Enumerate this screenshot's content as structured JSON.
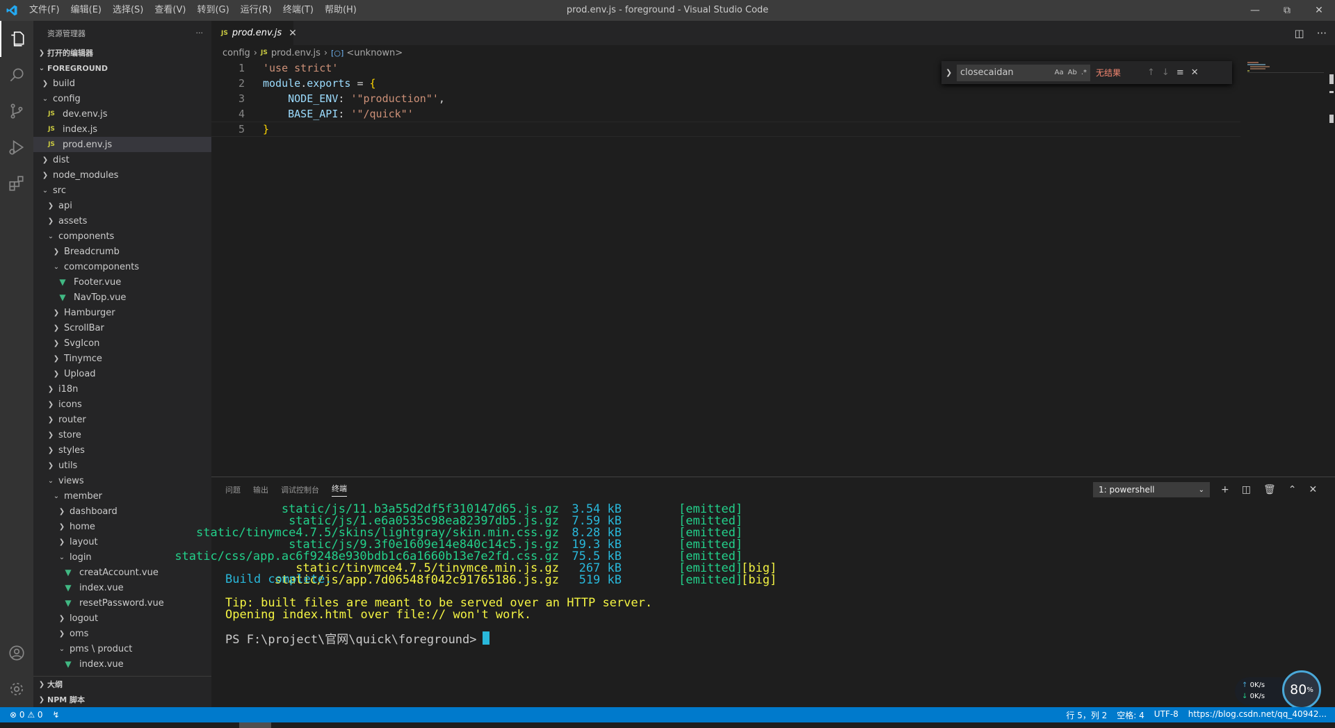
{
  "titlebar": {
    "menu": [
      "文件(F)",
      "编辑(E)",
      "选择(S)",
      "查看(V)",
      "转到(G)",
      "运行(R)",
      "终端(T)",
      "帮助(H)"
    ],
    "title": "prod.env.js - foreground - Visual Studio Code"
  },
  "sidebar": {
    "header": "资源管理器",
    "more": "···",
    "open_editors": "打开的编辑器",
    "root": "FOREGROUND",
    "tree": [
      {
        "label": "build",
        "depth": 0,
        "kind": "folder-closed"
      },
      {
        "label": "config",
        "depth": 0,
        "kind": "folder-open"
      },
      {
        "label": "dev.env.js",
        "depth": 1,
        "kind": "js"
      },
      {
        "label": "index.js",
        "depth": 1,
        "kind": "js"
      },
      {
        "label": "prod.env.js",
        "depth": 1,
        "kind": "js",
        "selected": true
      },
      {
        "label": "dist",
        "depth": 0,
        "kind": "folder-closed"
      },
      {
        "label": "node_modules",
        "depth": 0,
        "kind": "folder-closed"
      },
      {
        "label": "src",
        "depth": 0,
        "kind": "folder-open"
      },
      {
        "label": "api",
        "depth": 1,
        "kind": "folder-closed"
      },
      {
        "label": "assets",
        "depth": 1,
        "kind": "folder-closed"
      },
      {
        "label": "components",
        "depth": 1,
        "kind": "folder-open"
      },
      {
        "label": "Breadcrumb",
        "depth": 2,
        "kind": "folder-closed"
      },
      {
        "label": "comcomponents",
        "depth": 2,
        "kind": "folder-open"
      },
      {
        "label": "Footer.vue",
        "depth": 3,
        "kind": "vue"
      },
      {
        "label": "NavTop.vue",
        "depth": 3,
        "kind": "vue"
      },
      {
        "label": "Hamburger",
        "depth": 2,
        "kind": "folder-closed"
      },
      {
        "label": "ScrollBar",
        "depth": 2,
        "kind": "folder-closed"
      },
      {
        "label": "SvgIcon",
        "depth": 2,
        "kind": "folder-closed"
      },
      {
        "label": "Tinymce",
        "depth": 2,
        "kind": "folder-closed"
      },
      {
        "label": "Upload",
        "depth": 2,
        "kind": "folder-closed"
      },
      {
        "label": "i18n",
        "depth": 1,
        "kind": "folder-closed"
      },
      {
        "label": "icons",
        "depth": 1,
        "kind": "folder-closed"
      },
      {
        "label": "router",
        "depth": 1,
        "kind": "folder-closed"
      },
      {
        "label": "store",
        "depth": 1,
        "kind": "folder-closed"
      },
      {
        "label": "styles",
        "depth": 1,
        "kind": "folder-closed"
      },
      {
        "label": "utils",
        "depth": 1,
        "kind": "folder-closed"
      },
      {
        "label": "views",
        "depth": 1,
        "kind": "folder-open"
      },
      {
        "label": "member",
        "depth": 2,
        "kind": "folder-open"
      },
      {
        "label": "dashboard",
        "depth": 3,
        "kind": "folder-closed"
      },
      {
        "label": "home",
        "depth": 3,
        "kind": "folder-closed"
      },
      {
        "label": "layout",
        "depth": 3,
        "kind": "folder-closed"
      },
      {
        "label": "login",
        "depth": 3,
        "kind": "folder-open"
      },
      {
        "label": "creatAccount.vue",
        "depth": 4,
        "kind": "vue"
      },
      {
        "label": "index.vue",
        "depth": 4,
        "kind": "vue"
      },
      {
        "label": "resetPassword.vue",
        "depth": 4,
        "kind": "vue"
      },
      {
        "label": "logout",
        "depth": 3,
        "kind": "folder-closed"
      },
      {
        "label": "oms",
        "depth": 3,
        "kind": "folder-closed"
      },
      {
        "label": "pms \\ product",
        "depth": 3,
        "kind": "folder-open"
      },
      {
        "label": "index.vue",
        "depth": 4,
        "kind": "vue"
      }
    ],
    "outline": "大纲",
    "npm": "NPM 脚本"
  },
  "tabs": [
    {
      "label": "prod.env.js",
      "icon": "JS"
    }
  ],
  "breadcrumb": {
    "folder": "config",
    "file": "prod.env.js",
    "symbol": "<unknown>"
  },
  "editor": {
    "line_numbers": [
      "1",
      "2",
      "3",
      "4",
      "5"
    ]
  },
  "find": {
    "value": "closecaidan",
    "opt_case": "Aa",
    "opt_word": "Ab",
    "opt_regex": ".*",
    "no_results": "无结果"
  },
  "panel": {
    "tabs": [
      "问题",
      "输出",
      "调试控制台",
      "终端"
    ],
    "terminal_select": "1: powershell",
    "assets": [
      {
        "name": "static/js/11.b3a55d2df5f310147d65.js.gz",
        "size": "3.54 kB",
        "status": "[emitted]",
        "flag": "",
        "big": false
      },
      {
        "name": "static/js/1.e6a0535c98ea82397db5.js.gz",
        "size": "7.59 kB",
        "status": "[emitted]",
        "flag": "",
        "big": false
      },
      {
        "name": "static/tinymce4.7.5/skins/lightgray/skin.min.css.gz",
        "size": "8.28 kB",
        "status": "[emitted]",
        "flag": "",
        "big": false
      },
      {
        "name": "static/js/9.3f0e1609e14e840c14c5.js.gz",
        "size": "19.3 kB",
        "status": "[emitted]",
        "flag": "",
        "big": false
      },
      {
        "name": "static/css/app.ac6f9248e930bdb1c6a1660b13e7e2fd.css.gz",
        "size": "75.5 kB",
        "status": "[emitted]",
        "flag": "",
        "big": false
      },
      {
        "name": "static/tinymce4.7.5/tinymce.min.js.gz",
        "size": "267 kB",
        "status": "[emitted]",
        "flag": "[big]",
        "big": true
      },
      {
        "name": "static/js/app.7d06548f042c91765186.js.gz",
        "size": "519 kB",
        "status": "[emitted]",
        "flag": "[big]",
        "big": true
      }
    ],
    "build_complete": "Build complete.",
    "tip1": "Tip: built files are meant to be served over an HTTP server.",
    "tip2": "Opening index.html over file:// won't work.",
    "prompt": "PS F:\\project\\官网\\quick\\foreground>"
  },
  "perf": {
    "up": "0K/s",
    "down": "0K/s",
    "percent": "80",
    "unit": "%"
  },
  "statusbar": {
    "errors": "0",
    "warnings": "0",
    "position": "行 5，列 2",
    "spaces": "空格: 4",
    "encoding": "UTF-8",
    "watermark": "https://blog.csdn.net/qq_40942..."
  },
  "colors": {
    "accent": "#007acc",
    "string": "#ce9178",
    "variable": "#9cdcfe",
    "term_green": "#23d18b",
    "term_yellow": "#f5f543",
    "term_cyan": "#29b8db"
  }
}
